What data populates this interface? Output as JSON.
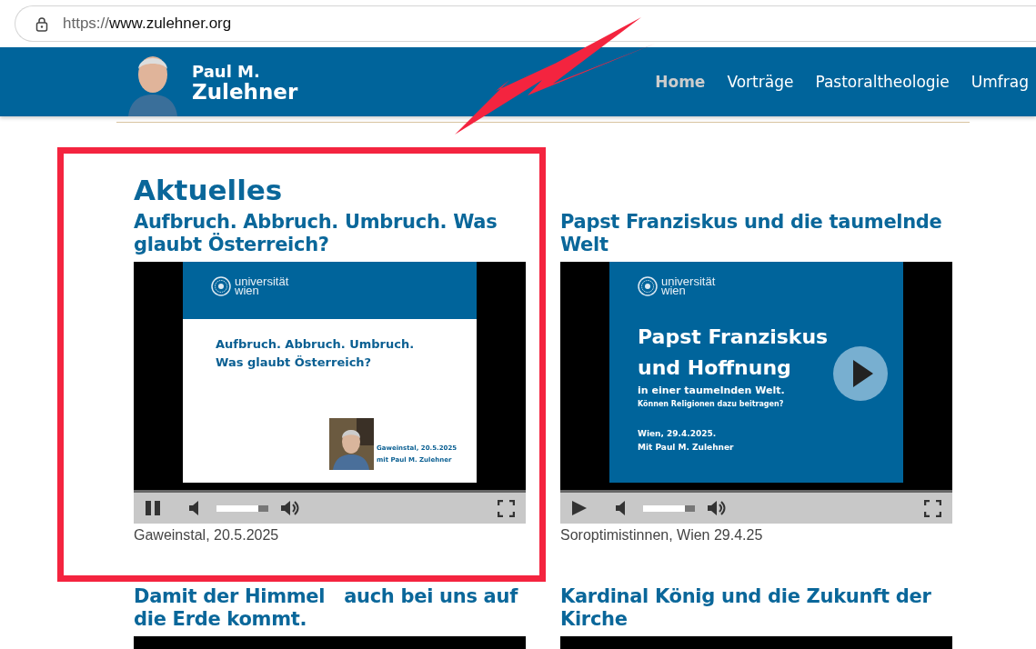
{
  "browser": {
    "url_scheme": "https://",
    "url_host": "www.zulehner.org"
  },
  "header": {
    "logo_line1": "Paul M.",
    "logo_line2": "Zulehner",
    "nav": [
      {
        "label": "Home",
        "selected": true
      },
      {
        "label": "Vorträge",
        "selected": false
      },
      {
        "label": "Pastoraltheologie",
        "selected": false
      },
      {
        "label": "Umfrag",
        "selected": false
      }
    ]
  },
  "section_title": "Aktuelles",
  "posts": [
    {
      "title": "Aufbruch. Abbruch. Umbruch. Was glaubt Österreich?",
      "caption": "Gaweinstal, 20.5.2025",
      "video": {
        "playing": true,
        "volume": {
          "level": 0.8
        },
        "slide": {
          "kind": "light",
          "brand": [
            "universität",
            "wien"
          ],
          "lines": [
            "Aufbruch. Abbruch. Umbruch.",
            "Was glaubt Österreich?"
          ],
          "footer": [
            "Gaweinstal, 20.5.2025",
            "mit Paul M. Zulehner"
          ]
        }
      }
    },
    {
      "title": "Papst Franziskus und die taumelnde Welt",
      "caption": "Soroptimistinnen, Wien 29.4.25",
      "video": {
        "playing": false,
        "volume": {
          "level": 0.8
        },
        "slide": {
          "kind": "dark",
          "brand": [
            "universität",
            "wien"
          ],
          "lines": [
            "Papst Franziskus",
            "und Hoffnung"
          ],
          "sub": [
            "in einer taumelnden Welt.",
            "Können Religionen dazu beitragen?"
          ],
          "footer": [
            "Wien, 29.4.2025.",
            "Mit Paul M. Zulehner"
          ]
        }
      }
    },
    {
      "title": "Damit der Himmel   auch bei uns auf die Erde kommt."
    },
    {
      "title": "Kardinal König und die Zukunft der Kirche"
    }
  ],
  "annotations": {
    "highlight_frame": true,
    "lightning_arrow": true
  }
}
